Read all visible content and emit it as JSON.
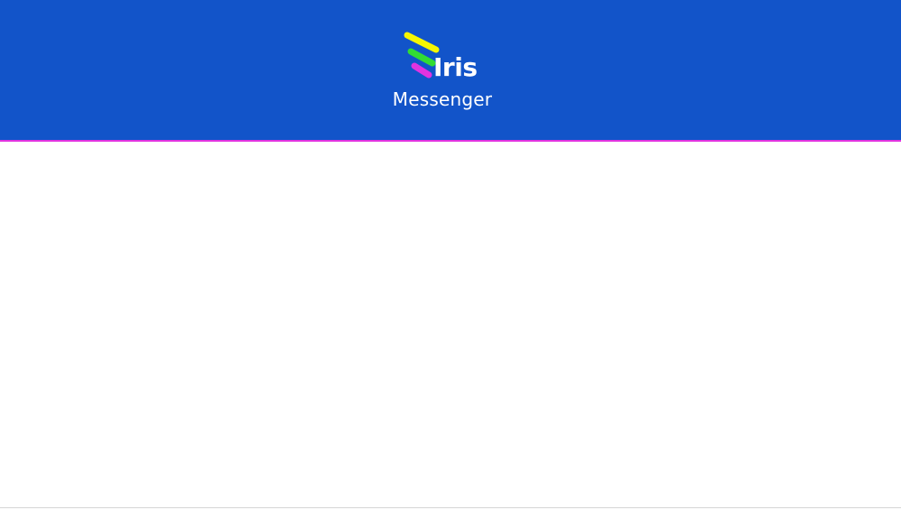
{
  "header": {
    "logo": {
      "wordmark": "Iris",
      "subtitle": "Messenger",
      "icon": "iris-stripes-logo-icon",
      "stripe_colors": [
        "#f6f700",
        "#32dc33",
        "#e133e0"
      ]
    },
    "background_color": "#1254c9",
    "accent_line_color": "#e133e0"
  },
  "content": {
    "background_color": "#ffffff"
  }
}
